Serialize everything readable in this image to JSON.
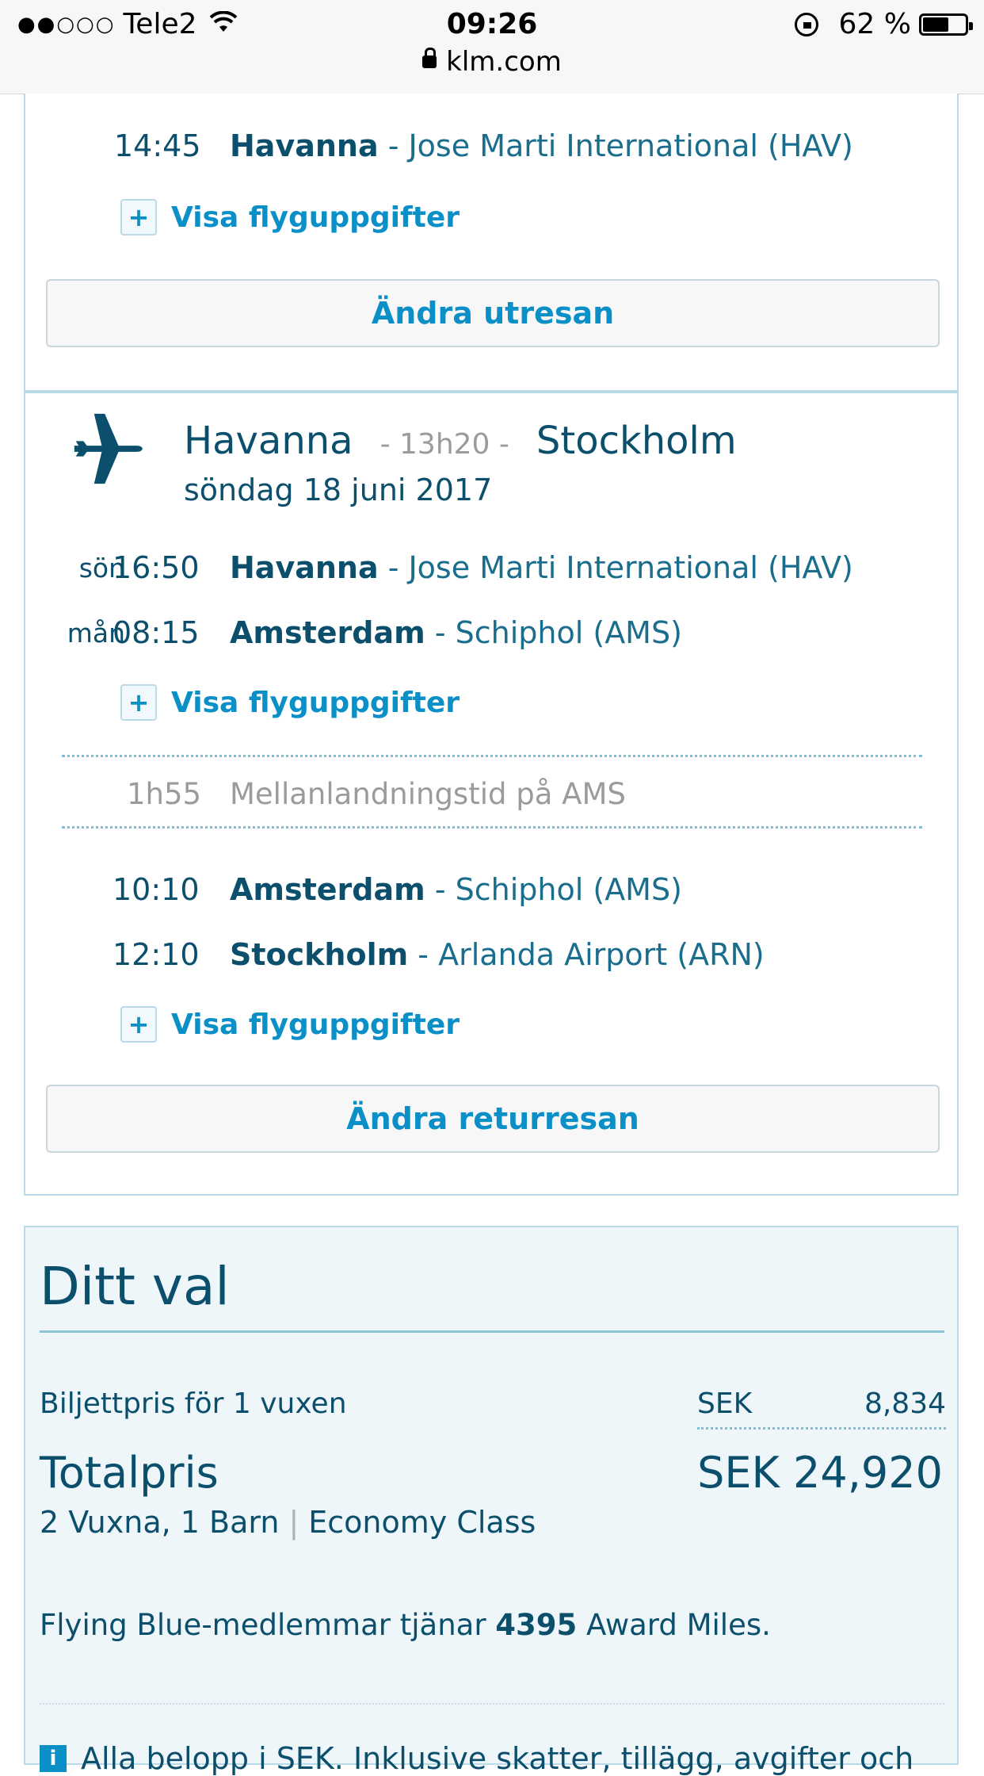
{
  "status_bar": {
    "carrier": "Tele2",
    "signal_dots": "●●○○○",
    "time": "09:26",
    "battery_percent": "62 %",
    "battery_level": 0.62,
    "url": "klm.com"
  },
  "outbound": {
    "segment_time": "14:45",
    "segment_city": "Havanna",
    "segment_airport": " - Jose Marti International (HAV)",
    "details_label": "Visa flyguppgifter",
    "change_button": "Ändra utresan"
  },
  "return_trip": {
    "from_city": "Havanna",
    "duration": "- 13h20 -",
    "to_city": "Stockholm",
    "date": "söndag 18 juni 2017",
    "segments": [
      {
        "day": "sön",
        "time": "16:50",
        "city": "Havanna",
        "airport": " - Jose Marti International (HAV)"
      },
      {
        "day": "mån",
        "time": "08:15",
        "city": "Amsterdam",
        "airport": " - Schiphol (AMS)"
      },
      {
        "day": "",
        "time": "10:10",
        "city": "Amsterdam",
        "airport": " - Schiphol (AMS)"
      },
      {
        "day": "",
        "time": "12:10",
        "city": "Stockholm",
        "airport": " - Arlanda Airport (ARN)"
      }
    ],
    "details_label": "Visa flyguppgifter",
    "layover_time": "1h55",
    "layover_text": "Mellanlandningstid på AMS",
    "change_button": "Ändra returresan"
  },
  "summary": {
    "title": "Ditt val",
    "ticket_label": "Biljettpris för 1 vuxen",
    "ticket_currency": "SEK",
    "ticket_value": "8,834",
    "total_label": "Totalpris",
    "total_value": "SEK 24,920",
    "passengers": "2 Vuxna, 1 Barn",
    "separator": "|",
    "cabin_class": "Economy Class",
    "miles_prefix": "Flying Blue-medlemmar tjänar ",
    "miles_value": "4395",
    "miles_suffix": " Award Miles.",
    "info_icon": "i",
    "info_text": "Alla belopp i SEK. Inklusive skatter, tillägg, avgifter och"
  },
  "icons": {
    "plane": "plane-icon",
    "plus": "+",
    "wifi": "wifi-icon",
    "lock": "padlock-icon",
    "rotation_lock": "rotation-lock-icon"
  },
  "colors": {
    "brand_dark": "#0b4f6c",
    "link_blue": "#0a8fc7",
    "muted_gray": "#9b9b9b",
    "card_border": "#b9dbe8"
  }
}
